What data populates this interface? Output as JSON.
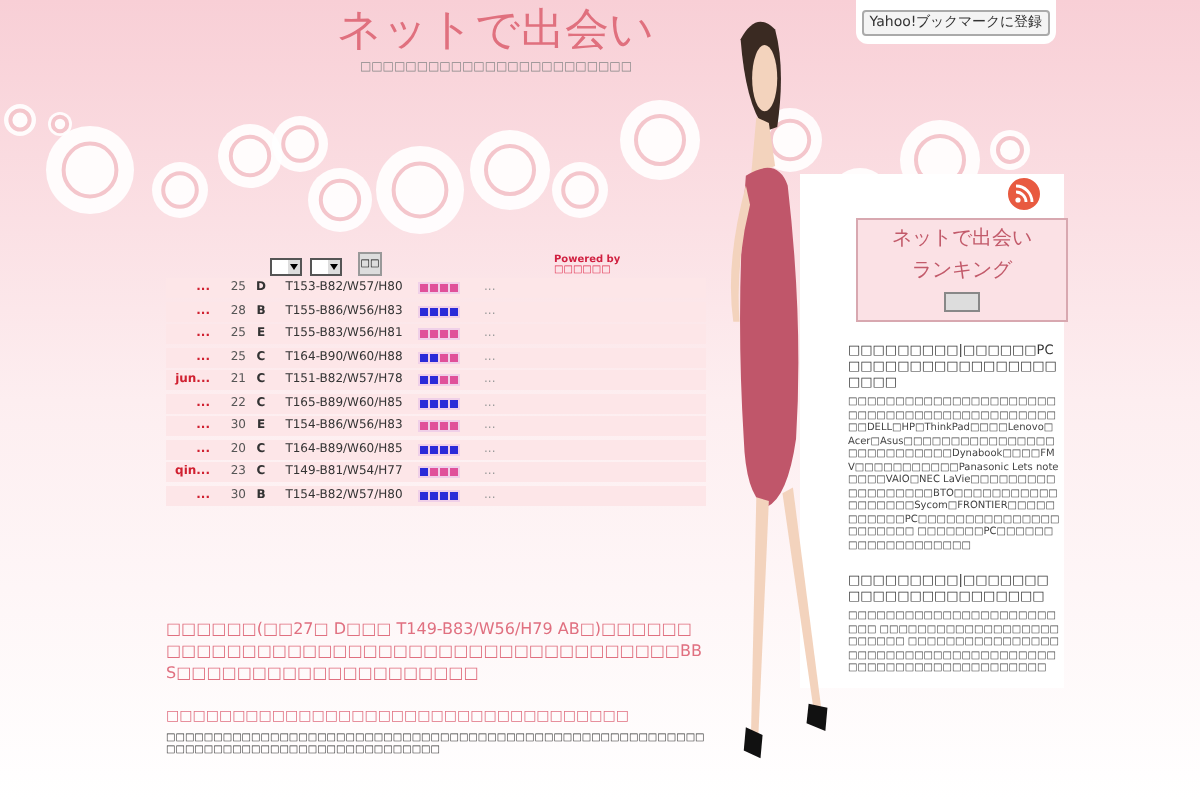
{
  "header": {
    "title": "ネットで出会い",
    "subtitle": "□□□□□□□□□□□□□□□□□□□□□□□□"
  },
  "bookmark_button": {
    "label": "Yahoo!ブックマークに登録"
  },
  "filters": {
    "selects": [
      {
        "kind": "dropdown"
      },
      {
        "kind": "dropdown"
      }
    ],
    "button": "□□",
    "powered_by": "Powered by",
    "powered_logo": "□□□□□□"
  },
  "rows": [
    {
      "name": "...",
      "age": "25",
      "cup": "D",
      "size": "T153-B82/W57/H80",
      "bar": [
        {
          "color": "#e0509a"
        },
        {
          "color": "#e0509a"
        },
        {
          "color": "#e0509a"
        },
        {
          "color": "#e0509a"
        }
      ],
      "more": "..."
    },
    {
      "name": "...",
      "age": "28",
      "cup": "B",
      "size": "T155-B86/W56/H83",
      "bar": [
        {
          "color": "#2a2ad8"
        },
        {
          "color": "#2a2ad8"
        },
        {
          "color": "#2a2ad8"
        },
        {
          "color": "#2a2ad8"
        }
      ],
      "more": "..."
    },
    {
      "name": "...",
      "age": "25",
      "cup": "E",
      "size": "T155-B83/W56/H81",
      "bar": [
        {
          "color": "#e0509a"
        },
        {
          "color": "#e0509a"
        },
        {
          "color": "#e0509a"
        },
        {
          "color": "#e0509a"
        }
      ],
      "more": "..."
    },
    {
      "name": "...",
      "age": "25",
      "cup": "C",
      "size": "T164-B90/W60/H88",
      "bar": [
        {
          "color": "#2a2ad8"
        },
        {
          "color": "#2a2ad8"
        },
        {
          "color": "#e0509a"
        },
        {
          "color": "#e0509a"
        }
      ],
      "more": "..."
    },
    {
      "name": "jun...",
      "age": "21",
      "cup": "C",
      "size": "T151-B82/W57/H78",
      "bar": [
        {
          "color": "#2a2ad8"
        },
        {
          "color": "#2a2ad8"
        },
        {
          "color": "#e0509a"
        },
        {
          "color": "#e0509a"
        }
      ],
      "more": "..."
    },
    {
      "name": "...",
      "age": "22",
      "cup": "C",
      "size": "T165-B89/W60/H85",
      "bar": [
        {
          "color": "#2a2ad8"
        },
        {
          "color": "#2a2ad8"
        },
        {
          "color": "#2a2ad8"
        },
        {
          "color": "#2a2ad8"
        }
      ],
      "more": "..."
    },
    {
      "name": "...",
      "age": "30",
      "cup": "E",
      "size": "T154-B86/W56/H83",
      "bar": [
        {
          "color": "#e0509a"
        },
        {
          "color": "#e0509a"
        },
        {
          "color": "#e0509a"
        },
        {
          "color": "#e0509a"
        }
      ],
      "more": "..."
    },
    {
      "name": "...",
      "age": "20",
      "cup": "C",
      "size": "T164-B89/W60/H85",
      "bar": [
        {
          "color": "#2a2ad8"
        },
        {
          "color": "#2a2ad8"
        },
        {
          "color": "#2a2ad8"
        },
        {
          "color": "#2a2ad8"
        }
      ],
      "more": "..."
    },
    {
      "name": "qin...",
      "age": "23",
      "cup": "C",
      "size": "T149-B81/W54/H77",
      "bar": [
        {
          "color": "#2a2ad8"
        },
        {
          "color": "#e0509a"
        },
        {
          "color": "#e0509a"
        },
        {
          "color": "#e0509a"
        }
      ],
      "more": "..."
    },
    {
      "name": "...",
      "age": "30",
      "cup": "B",
      "size": "T154-B82/W57/H80",
      "bar": [
        {
          "color": "#2a2ad8"
        },
        {
          "color": "#2a2ad8"
        },
        {
          "color": "#2a2ad8"
        },
        {
          "color": "#2a2ad8"
        }
      ],
      "more": "..."
    }
  ],
  "article": {
    "headline": "□□□□□□(□□27□ D□□□ T149-B83/W56/H79 AB□)□□□□□□□□□□□□□□□□□□□□□□□□□□□□□□□□□□□□□□□□BBS□□□□□□□□□□□□□□□□□□□□",
    "heading": "□□□□□□□□□□□□□□□□□□□□□□□□□□□□□□□□□□□",
    "body": "□□□□□□□□□□□□□□□□□□□□□□□□□□□□□□□□□□□□□□□□□□□□□□□□□□□□□□□□□□□□□□□□□□□□□□□□□□□□□□□□□□□□□□"
  },
  "sidebar": {
    "ranking": {
      "title": "ネットで出会い",
      "subtitle": "ランキング"
    },
    "posts": [
      {
        "title": "□□□□□□□□□|□□□□□□PC□□□□□□□□□□□□□□□□□□□□□",
        "body": "□□□□□□□□□□□□□□□□□□□□□□□□□□□□□□□□□□□□□□□□□□□□□□DELL□HP□ThinkPad□□□□Lenovo□Acer□Asus□□□□□□□□□□□□□□□□□□□□□□□□□□□Dynabook□□□□FMV□□□□□□□□□□□Panasonic Lets note□□□□VAIO□NEC LaVie□□□□□□□□□□□□□□□□□□BTO□□□□□□□□□□□□□□□□□□Sycom□FRONTIER□□□□□□□□□□□PC□□□□□□□□□□□□□□□□□□□□□□ □□□□□□□PC□□□□□□□□□□□□□□□□□□□"
      },
      {
        "title": "□□□□□□□□□|□□□□□□□□□□□□□□□□□□□□□□□",
        "body": "□□□□□□□□□□□□□□□□□□□□□□□□□ □□□□□□□□□□□□□□□□□□□□□□□□□ □□□□□□□□□□□□□□□□□□□□□□□□□□□□□□□□□□□□□□ □□□□□□□□□□□□□□□□□□□□□"
      }
    ]
  }
}
